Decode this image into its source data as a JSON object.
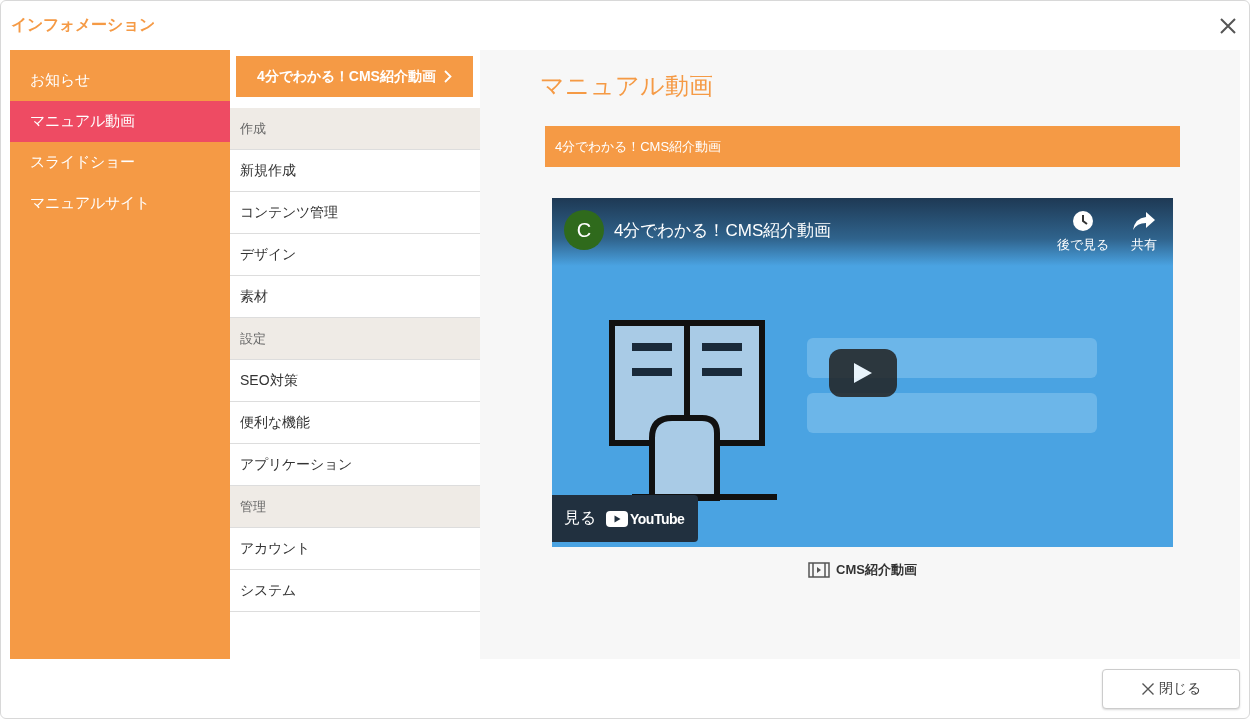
{
  "window": {
    "title": "インフォメーション"
  },
  "sidebar": {
    "items": [
      {
        "label": "お知らせ",
        "selected": false
      },
      {
        "label": "マニュアル動画",
        "selected": true
      },
      {
        "label": "スライドショー",
        "selected": false
      },
      {
        "label": "マニュアルサイト",
        "selected": false
      }
    ]
  },
  "submenu": {
    "button": "4分でわかる！CMS紹介動画",
    "items": [
      {
        "kind": "header",
        "label": "作成"
      },
      {
        "kind": "link",
        "label": "新規作成"
      },
      {
        "kind": "link",
        "label": "コンテンツ管理"
      },
      {
        "kind": "link",
        "label": "デザイン"
      },
      {
        "kind": "link",
        "label": "素材"
      },
      {
        "kind": "header",
        "label": "設定"
      },
      {
        "kind": "link",
        "label": "SEO対策"
      },
      {
        "kind": "link",
        "label": "便利な機能"
      },
      {
        "kind": "link",
        "label": "アプリケーション"
      },
      {
        "kind": "header",
        "label": "管理"
      },
      {
        "kind": "link",
        "label": "アカウント"
      },
      {
        "kind": "link",
        "label": "システム"
      }
    ]
  },
  "content": {
    "heading": "マニュアル動画",
    "banner": "4分でわかる！CMS紹介動画",
    "video": {
      "kind": "picture",
      "avatar": "C",
      "title": "4分でわかる！CMS紹介動画",
      "watch_later": "後で見る",
      "share": "共有",
      "watch": "見る",
      "brand": "YouTube"
    },
    "caption": "CMS紹介動画"
  },
  "footer": {
    "close_button": "閉じる"
  }
}
